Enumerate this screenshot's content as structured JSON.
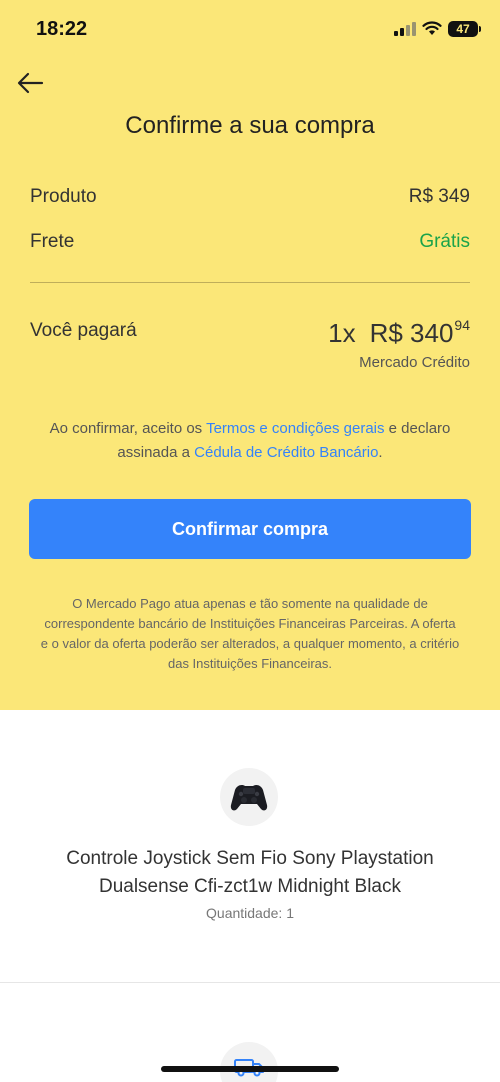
{
  "status_bar": {
    "time": "18:22",
    "battery": "47"
  },
  "header": {
    "title": "Confirme a sua compra"
  },
  "summary": {
    "product_label": "Produto",
    "product_value": "R$ 349",
    "shipping_label": "Frete",
    "shipping_value": "Grátis",
    "shipping_color": "#1aa34a"
  },
  "payment": {
    "label": "Você pagará",
    "installments": "1x",
    "amount_main": "R$ 340",
    "amount_cents": "94",
    "method": "Mercado Crédito"
  },
  "terms": {
    "text_1": "Ao confirmar, aceito os ",
    "link_1": "Termos e condições gerais",
    "text_2": " e declaro assinada a ",
    "link_2": "Cédula de Crédito Bancário",
    "text_3": "."
  },
  "confirm_button": {
    "label": "Confirmar compra",
    "color": "#3483fa"
  },
  "disclaimer": "O Mercado Pago atua apenas e tão somente na qualidade de correspondente bancário de Instituições Financeiras Parceiras. A oferta e o valor da oferta poderão ser alterados, a qualquer momento, a critério das Instituições Financeiras.",
  "product": {
    "name": "Controle Joystick Sem Fio Sony Playstation Dualsense Cfi-zct1w Midnight Black",
    "quantity": "Quantidade: 1",
    "icon": "gamepad-icon"
  },
  "shipping": {
    "icon": "truck-icon"
  },
  "colors": {
    "background_top": "#fbe778",
    "link": "#3483fa"
  }
}
